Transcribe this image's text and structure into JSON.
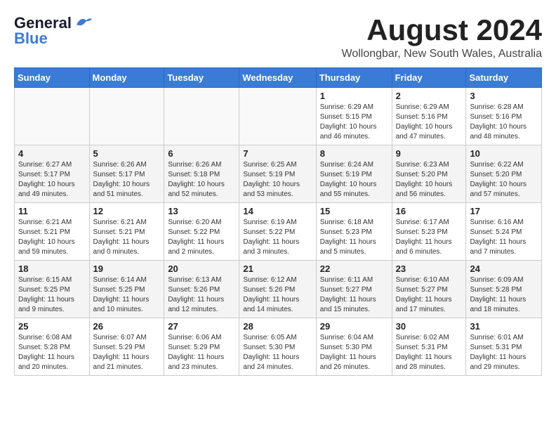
{
  "header": {
    "logo_general": "General",
    "logo_blue": "Blue",
    "month_year": "August 2024",
    "location": "Wollongbar, New South Wales, Australia"
  },
  "weekdays": [
    "Sunday",
    "Monday",
    "Tuesday",
    "Wednesday",
    "Thursday",
    "Friday",
    "Saturday"
  ],
  "weeks": [
    [
      {
        "day": "",
        "sunrise": "",
        "sunset": "",
        "daylight": ""
      },
      {
        "day": "",
        "sunrise": "",
        "sunset": "",
        "daylight": ""
      },
      {
        "day": "",
        "sunrise": "",
        "sunset": "",
        "daylight": ""
      },
      {
        "day": "",
        "sunrise": "",
        "sunset": "",
        "daylight": ""
      },
      {
        "day": "1",
        "sunrise": "Sunrise: 6:29 AM",
        "sunset": "Sunset: 5:15 PM",
        "daylight": "Daylight: 10 hours and 46 minutes."
      },
      {
        "day": "2",
        "sunrise": "Sunrise: 6:29 AM",
        "sunset": "Sunset: 5:16 PM",
        "daylight": "Daylight: 10 hours and 47 minutes."
      },
      {
        "day": "3",
        "sunrise": "Sunrise: 6:28 AM",
        "sunset": "Sunset: 5:16 PM",
        "daylight": "Daylight: 10 hours and 48 minutes."
      }
    ],
    [
      {
        "day": "4",
        "sunrise": "Sunrise: 6:27 AM",
        "sunset": "Sunset: 5:17 PM",
        "daylight": "Daylight: 10 hours and 49 minutes."
      },
      {
        "day": "5",
        "sunrise": "Sunrise: 6:26 AM",
        "sunset": "Sunset: 5:17 PM",
        "daylight": "Daylight: 10 hours and 51 minutes."
      },
      {
        "day": "6",
        "sunrise": "Sunrise: 6:26 AM",
        "sunset": "Sunset: 5:18 PM",
        "daylight": "Daylight: 10 hours and 52 minutes."
      },
      {
        "day": "7",
        "sunrise": "Sunrise: 6:25 AM",
        "sunset": "Sunset: 5:19 PM",
        "daylight": "Daylight: 10 hours and 53 minutes."
      },
      {
        "day": "8",
        "sunrise": "Sunrise: 6:24 AM",
        "sunset": "Sunset: 5:19 PM",
        "daylight": "Daylight: 10 hours and 55 minutes."
      },
      {
        "day": "9",
        "sunrise": "Sunrise: 6:23 AM",
        "sunset": "Sunset: 5:20 PM",
        "daylight": "Daylight: 10 hours and 56 minutes."
      },
      {
        "day": "10",
        "sunrise": "Sunrise: 6:22 AM",
        "sunset": "Sunset: 5:20 PM",
        "daylight": "Daylight: 10 hours and 57 minutes."
      }
    ],
    [
      {
        "day": "11",
        "sunrise": "Sunrise: 6:21 AM",
        "sunset": "Sunset: 5:21 PM",
        "daylight": "Daylight: 10 hours and 59 minutes."
      },
      {
        "day": "12",
        "sunrise": "Sunrise: 6:21 AM",
        "sunset": "Sunset: 5:21 PM",
        "daylight": "Daylight: 11 hours and 0 minutes."
      },
      {
        "day": "13",
        "sunrise": "Sunrise: 6:20 AM",
        "sunset": "Sunset: 5:22 PM",
        "daylight": "Daylight: 11 hours and 2 minutes."
      },
      {
        "day": "14",
        "sunrise": "Sunrise: 6:19 AM",
        "sunset": "Sunset: 5:22 PM",
        "daylight": "Daylight: 11 hours and 3 minutes."
      },
      {
        "day": "15",
        "sunrise": "Sunrise: 6:18 AM",
        "sunset": "Sunset: 5:23 PM",
        "daylight": "Daylight: 11 hours and 5 minutes."
      },
      {
        "day": "16",
        "sunrise": "Sunrise: 6:17 AM",
        "sunset": "Sunset: 5:23 PM",
        "daylight": "Daylight: 11 hours and 6 minutes."
      },
      {
        "day": "17",
        "sunrise": "Sunrise: 6:16 AM",
        "sunset": "Sunset: 5:24 PM",
        "daylight": "Daylight: 11 hours and 7 minutes."
      }
    ],
    [
      {
        "day": "18",
        "sunrise": "Sunrise: 6:15 AM",
        "sunset": "Sunset: 5:25 PM",
        "daylight": "Daylight: 11 hours and 9 minutes."
      },
      {
        "day": "19",
        "sunrise": "Sunrise: 6:14 AM",
        "sunset": "Sunset: 5:25 PM",
        "daylight": "Daylight: 11 hours and 10 minutes."
      },
      {
        "day": "20",
        "sunrise": "Sunrise: 6:13 AM",
        "sunset": "Sunset: 5:26 PM",
        "daylight": "Daylight: 11 hours and 12 minutes."
      },
      {
        "day": "21",
        "sunrise": "Sunrise: 6:12 AM",
        "sunset": "Sunset: 5:26 PM",
        "daylight": "Daylight: 11 hours and 14 minutes."
      },
      {
        "day": "22",
        "sunrise": "Sunrise: 6:11 AM",
        "sunset": "Sunset: 5:27 PM",
        "daylight": "Daylight: 11 hours and 15 minutes."
      },
      {
        "day": "23",
        "sunrise": "Sunrise: 6:10 AM",
        "sunset": "Sunset: 5:27 PM",
        "daylight": "Daylight: 11 hours and 17 minutes."
      },
      {
        "day": "24",
        "sunrise": "Sunrise: 6:09 AM",
        "sunset": "Sunset: 5:28 PM",
        "daylight": "Daylight: 11 hours and 18 minutes."
      }
    ],
    [
      {
        "day": "25",
        "sunrise": "Sunrise: 6:08 AM",
        "sunset": "Sunset: 5:28 PM",
        "daylight": "Daylight: 11 hours and 20 minutes."
      },
      {
        "day": "26",
        "sunrise": "Sunrise: 6:07 AM",
        "sunset": "Sunset: 5:29 PM",
        "daylight": "Daylight: 11 hours and 21 minutes."
      },
      {
        "day": "27",
        "sunrise": "Sunrise: 6:06 AM",
        "sunset": "Sunset: 5:29 PM",
        "daylight": "Daylight: 11 hours and 23 minutes."
      },
      {
        "day": "28",
        "sunrise": "Sunrise: 6:05 AM",
        "sunset": "Sunset: 5:30 PM",
        "daylight": "Daylight: 11 hours and 24 minutes."
      },
      {
        "day": "29",
        "sunrise": "Sunrise: 6:04 AM",
        "sunset": "Sunset: 5:30 PM",
        "daylight": "Daylight: 11 hours and 26 minutes."
      },
      {
        "day": "30",
        "sunrise": "Sunrise: 6:02 AM",
        "sunset": "Sunset: 5:31 PM",
        "daylight": "Daylight: 11 hours and 28 minutes."
      },
      {
        "day": "31",
        "sunrise": "Sunrise: 6:01 AM",
        "sunset": "Sunset: 5:31 PM",
        "daylight": "Daylight: 11 hours and 29 minutes."
      }
    ]
  ]
}
